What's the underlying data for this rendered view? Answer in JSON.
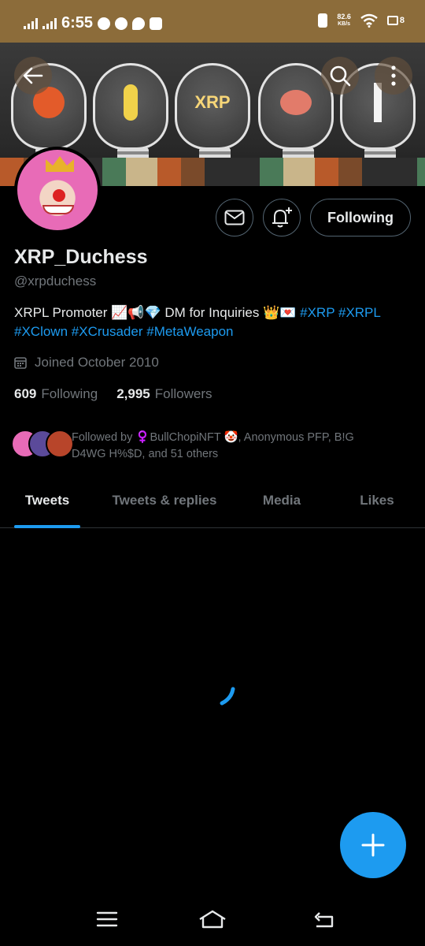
{
  "status_bar": {
    "time": "6:55",
    "speed_value": "82.6",
    "speed_unit": "KB/s",
    "battery": "8"
  },
  "header": {
    "back_icon": "arrow-left-icon",
    "search_icon": "search-icon",
    "more_icon": "more-vertical-icon"
  },
  "banner": {
    "bulb_label": "XRP"
  },
  "actions": {
    "message_icon": "envelope-icon",
    "notify_icon": "bell-plus-icon",
    "follow_label": "Following"
  },
  "profile": {
    "name": "XRP_Duchess",
    "handle": "@xrpduchess",
    "bio_text": "XRPL Promoter 📈📢💎 DM for Inquiries 👑💌",
    "bio_tags_line1": [
      "#XRP",
      "#XRPL"
    ],
    "bio_tags_line2": [
      "#XClown",
      "#XCrusader",
      "#MetaWeapon"
    ],
    "joined": "Joined October 2010",
    "following_count": "609",
    "following_label": "Following",
    "followers_count": "2,995",
    "followers_label": "Followers",
    "followed_by": "Followed by ♀️BullChopiNFT 🤡, Anonymous PFP, B!G D4WG H%$D, and 51 others"
  },
  "tabs": [
    {
      "label": "Tweets",
      "active": true
    },
    {
      "label": "Tweets & replies",
      "active": false
    },
    {
      "label": "Media",
      "active": false
    },
    {
      "label": "Likes",
      "active": false
    }
  ],
  "colors": {
    "accent": "#1d9bf0",
    "status_bar": "#8c6c3a",
    "background": "#000000"
  },
  "fab": {
    "icon": "plus-icon"
  },
  "navbar": {
    "menu_icon": "menu-icon",
    "home_icon": "home-icon",
    "back_icon": "back-icon"
  }
}
